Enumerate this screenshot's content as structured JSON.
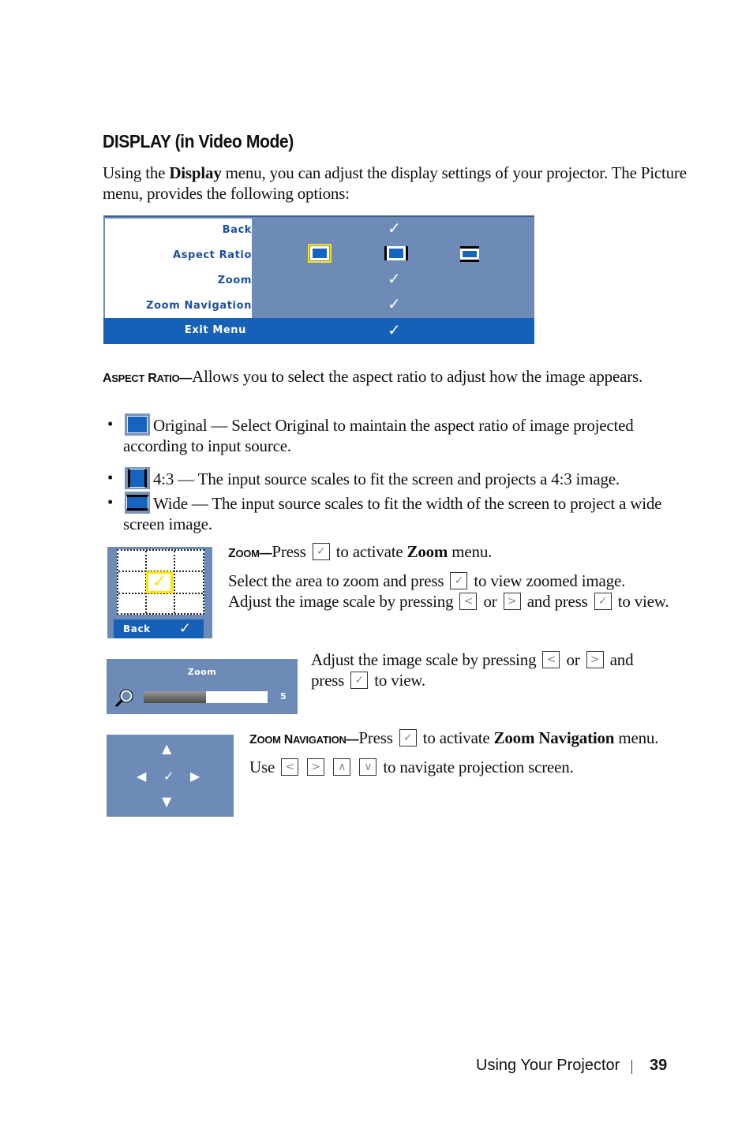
{
  "heading": "DISPLAY (in Video Mode)",
  "intro": {
    "part1": "Using the ",
    "bold": "Display",
    "part2": " menu, you can adjust the display settings of your projector. The Picture menu, provides the following options:"
  },
  "osd_menu": {
    "items": [
      "Back",
      "Aspect Ratio",
      "Zoom",
      "Zoom Navigation"
    ],
    "exit_label": "Exit Menu",
    "check_icon": "✓",
    "aspect_options": [
      "Original",
      "4:3",
      "Wide"
    ],
    "selected_aspect": "Original",
    "colors": {
      "panel": "#6d8bb6",
      "highlight": "#1760b8",
      "label": "#1f4f9c",
      "selection": "#ffe500"
    }
  },
  "aspect_ratio": {
    "title_cap1": "A",
    "title_small1": "SPECT",
    "title_cap2": " R",
    "title_small2": "ATIO",
    "dash": "—",
    "desc": "Allows you to select the aspect ratio to adjust how the image appears.",
    "bullets": [
      {
        "icon": "aspect-original-icon",
        "text": "Original — Select Original to maintain the aspect ratio of image projected according to input source."
      },
      {
        "icon": "aspect-4-3-icon",
        "text": "4:3 — The input source scales to fit the screen and projects a 4:3 image."
      },
      {
        "icon": "aspect-wide-icon",
        "text": "Wide — The input source scales to fit the width of the screen to project a wide screen image."
      }
    ]
  },
  "zoom": {
    "title_cap": "Z",
    "title_small": "OOM",
    "dash": "—",
    "line1_a": "Press ",
    "line1_b": " to activate ",
    "line1_bold": "Zoom",
    "line1_c": " menu.",
    "line2_a": "Select the area to zoom and press ",
    "line2_b": " to view zoomed image. Adjust the image scale by pressing ",
    "line2_c": " or ",
    "line2_d": " and press ",
    "line2_e": " to view.",
    "grid_back_label": "Back",
    "slider_title": "Zoom",
    "slider_value": "5",
    "slider_fill_fraction": 0.5,
    "adjust_a": "Adjust the image scale by pressing ",
    "adjust_b": " or ",
    "adjust_c": " and press ",
    "adjust_d": " to view."
  },
  "zoom_navigation": {
    "title_cap1": "Z",
    "title_small1": "OOM",
    "title_cap2": " N",
    "title_small2": "AVIGATION",
    "dash": "—",
    "line1_a": "Press ",
    "line1_b": " to activate ",
    "line1_bold": "Zoom Navigation",
    "line1_c": " menu.",
    "line2_a": "Use ",
    "line2_b": " to navigate projection screen."
  },
  "keys": {
    "left": "<",
    "right": ">",
    "up": "∧",
    "down": "∨",
    "enter": "✓"
  },
  "footer": {
    "section": "Using Your Projector",
    "page": "39"
  }
}
